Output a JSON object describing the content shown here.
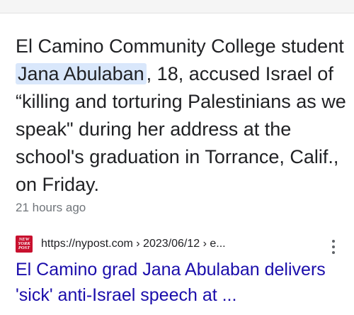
{
  "snippet": {
    "before": "El Camino Community College student ",
    "highlight": "Jana Abulaban",
    "after": ", 18, accused Israel of “killing and torturing Palestinians as we speak\" during her address at the school's graduation in Torrance, Calif., on Friday."
  },
  "timestamp": "21 hours ago",
  "result": {
    "favicon_text_1": "NEW",
    "favicon_text_2": "YORK",
    "favicon_text_3": "POST",
    "favicon_color": "#c8102e",
    "url": "https://nypost.com › 2023/06/12 › e...",
    "title": "El Camino grad Jana Abulaban delivers 'sick' anti-Israel speech at ...",
    "menu_icon": "more-vert-icon",
    "title_color": "#1a0dab"
  }
}
